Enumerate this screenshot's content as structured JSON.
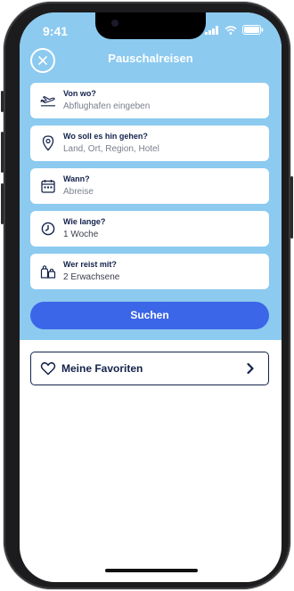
{
  "status_bar": {
    "time": "9:41"
  },
  "header": {
    "title": "Pauschalreisen"
  },
  "form": {
    "fields": [
      {
        "label": "Von wo?",
        "value": "Abflughafen eingeben",
        "icon": "plane-departure-icon"
      },
      {
        "label": "Wo soll es hin gehen?",
        "value": "Land, Ort, Region, Hotel",
        "icon": "location-pin-icon"
      },
      {
        "label": "Wann?",
        "value": "Abreise",
        "icon": "calendar-icon"
      },
      {
        "label": "Wie lange?",
        "value": "1 Woche",
        "icon": "clock-icon"
      },
      {
        "label": "Wer reist mit?",
        "value": "2 Erwachsene",
        "icon": "travelers-icon"
      }
    ],
    "search_label": "Suchen"
  },
  "favorites": {
    "label": "Meine Favoriten"
  },
  "colors": {
    "header_bg": "#8ccaf0",
    "accent": "#3c66e8",
    "text_dark": "#13224a",
    "placeholder": "#7a7f8c"
  }
}
